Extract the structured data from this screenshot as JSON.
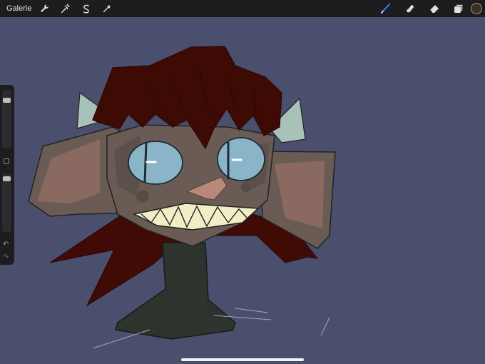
{
  "topbar": {
    "gallery_label": "Galerie",
    "left_tools": [
      "wrench-icon",
      "magic-wand-icon",
      "selection-icon",
      "transform-icon"
    ],
    "right_tools": [
      "brush-icon",
      "smudge-icon",
      "eraser-icon",
      "layers-icon"
    ],
    "active_tool": "brush-icon",
    "accent_color": "#3d7bf6",
    "current_color": "#3a2f25"
  },
  "sidebar": {
    "size_slider_level": 0.85,
    "opacity_slider_level": 0.95,
    "undo_icon": "undo-icon",
    "redo_icon": "redo-icon"
  },
  "canvas": {
    "background_color": "#4b4f6e"
  }
}
